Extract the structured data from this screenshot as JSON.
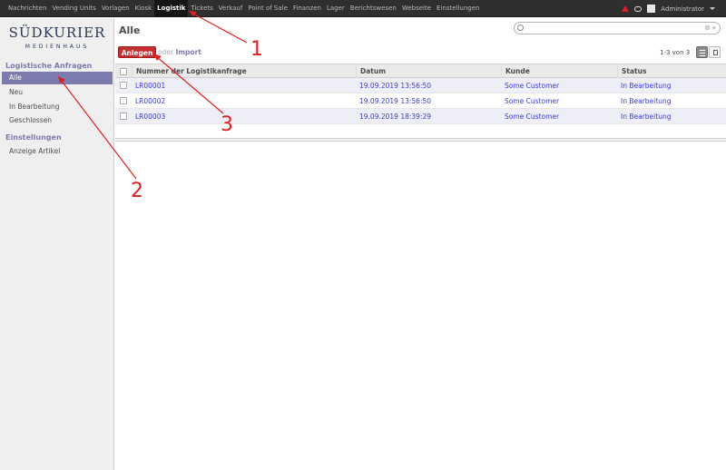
{
  "topbar": {
    "menu": [
      "Nachrichten",
      "Vending Units",
      "Vorlagen",
      "Kiosk",
      "Logistik",
      "Tickets",
      "Verkauf",
      "Point of Sale",
      "Finanzen",
      "Lager",
      "Berichtswesen",
      "Webseite",
      "Einstellungen"
    ],
    "active": "Logistik",
    "user": "Administrator",
    "icons": [
      "warning-icon",
      "chat-icon",
      "avatar",
      "chevron-down-icon"
    ],
    "colors": {
      "bar": "#2f2f2f",
      "warning": "#d9232a"
    }
  },
  "sidebar": {
    "logo": {
      "main": "SÜDKURIER",
      "sub": "MEDIENHAUS"
    },
    "sections": [
      {
        "title": "Logistische Anfragen",
        "items": [
          "Alle",
          "Neu",
          "In Bearbeitung",
          "Geschlossen"
        ]
      },
      {
        "title": "Einstellungen",
        "items": [
          "Anzeige Artikel"
        ]
      }
    ],
    "active_item": "Alle",
    "accent": "#7c7bad"
  },
  "main": {
    "title": "Alle",
    "search": {
      "placeholder": ""
    },
    "create_button": "Anlegen",
    "or_text": "oder",
    "import_link": "Import",
    "pager": "1-3 von 3",
    "button_color": "#c62f30"
  },
  "table": {
    "columns": [
      "Nummer der Logistikanfrage",
      "Datum",
      "Kunde",
      "Status"
    ],
    "rows": [
      [
        "LR00001",
        "19.09.2019 13:56:50",
        "Some Customer",
        "In Bearbeitung"
      ],
      [
        "LR00002",
        "19.09.2019 13:56:50",
        "Some Customer",
        "In Bearbeitung"
      ],
      [
        "LR00003",
        "19.09.2019 18:39:29",
        "Some Customer",
        "In Bearbeitung"
      ]
    ]
  },
  "annotations": {
    "labels": [
      "1",
      "2",
      "3"
    ],
    "color": "#e02020"
  }
}
